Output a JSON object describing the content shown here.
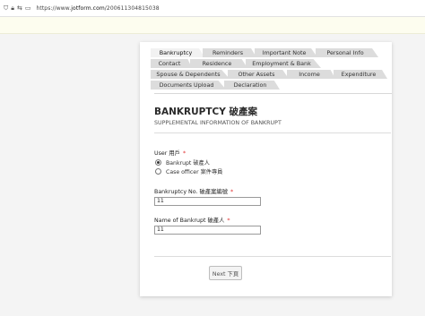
{
  "browser": {
    "url_prefix": "https://www.",
    "url_host": "jotform.com",
    "url_path": "/200611304815038",
    "icons": [
      "shield-icon",
      "lock-icon",
      "connection-icon",
      "tab-icon"
    ]
  },
  "tabs": [
    {
      "label": "Bankruptcy",
      "active": true
    },
    {
      "label": "Reminders",
      "active": false
    },
    {
      "label": "Important Note",
      "active": false
    },
    {
      "label": "Personal Info",
      "active": false
    },
    {
      "label": "Contact",
      "active": false
    },
    {
      "label": "Residence",
      "active": false
    },
    {
      "label": "Employment & Bank",
      "active": false
    },
    {
      "label": "Spouse & Dependents",
      "active": false
    },
    {
      "label": "Other Assets",
      "active": false
    },
    {
      "label": "Income",
      "active": false
    },
    {
      "label": "Expenditure",
      "active": false
    },
    {
      "label": "Documents Upload",
      "active": false
    },
    {
      "label": "Declaration",
      "active": false
    }
  ],
  "form": {
    "title": "BANKRUPTCY 破產案",
    "subtitle": "SUPPLEMENTAL INFORMATION OF BANKRUPT",
    "user_label": "User 用戶",
    "required_mark": "*",
    "radio_options": [
      {
        "label": "Bankrupt 破產人",
        "checked": true
      },
      {
        "label": "Case officer 案件專員",
        "checked": false
      }
    ],
    "bankruptcy_no_label": "Bankruptcy No. 破產案編號",
    "bankruptcy_no_value": "11",
    "name_label": "Name of Bankrupt 破產人",
    "name_value": "11",
    "next_button": "Next 下頁"
  },
  "colors": {
    "tab_bg": "#dcdcdc",
    "required": "#e03030",
    "notice_strip": "#fdfdef"
  }
}
